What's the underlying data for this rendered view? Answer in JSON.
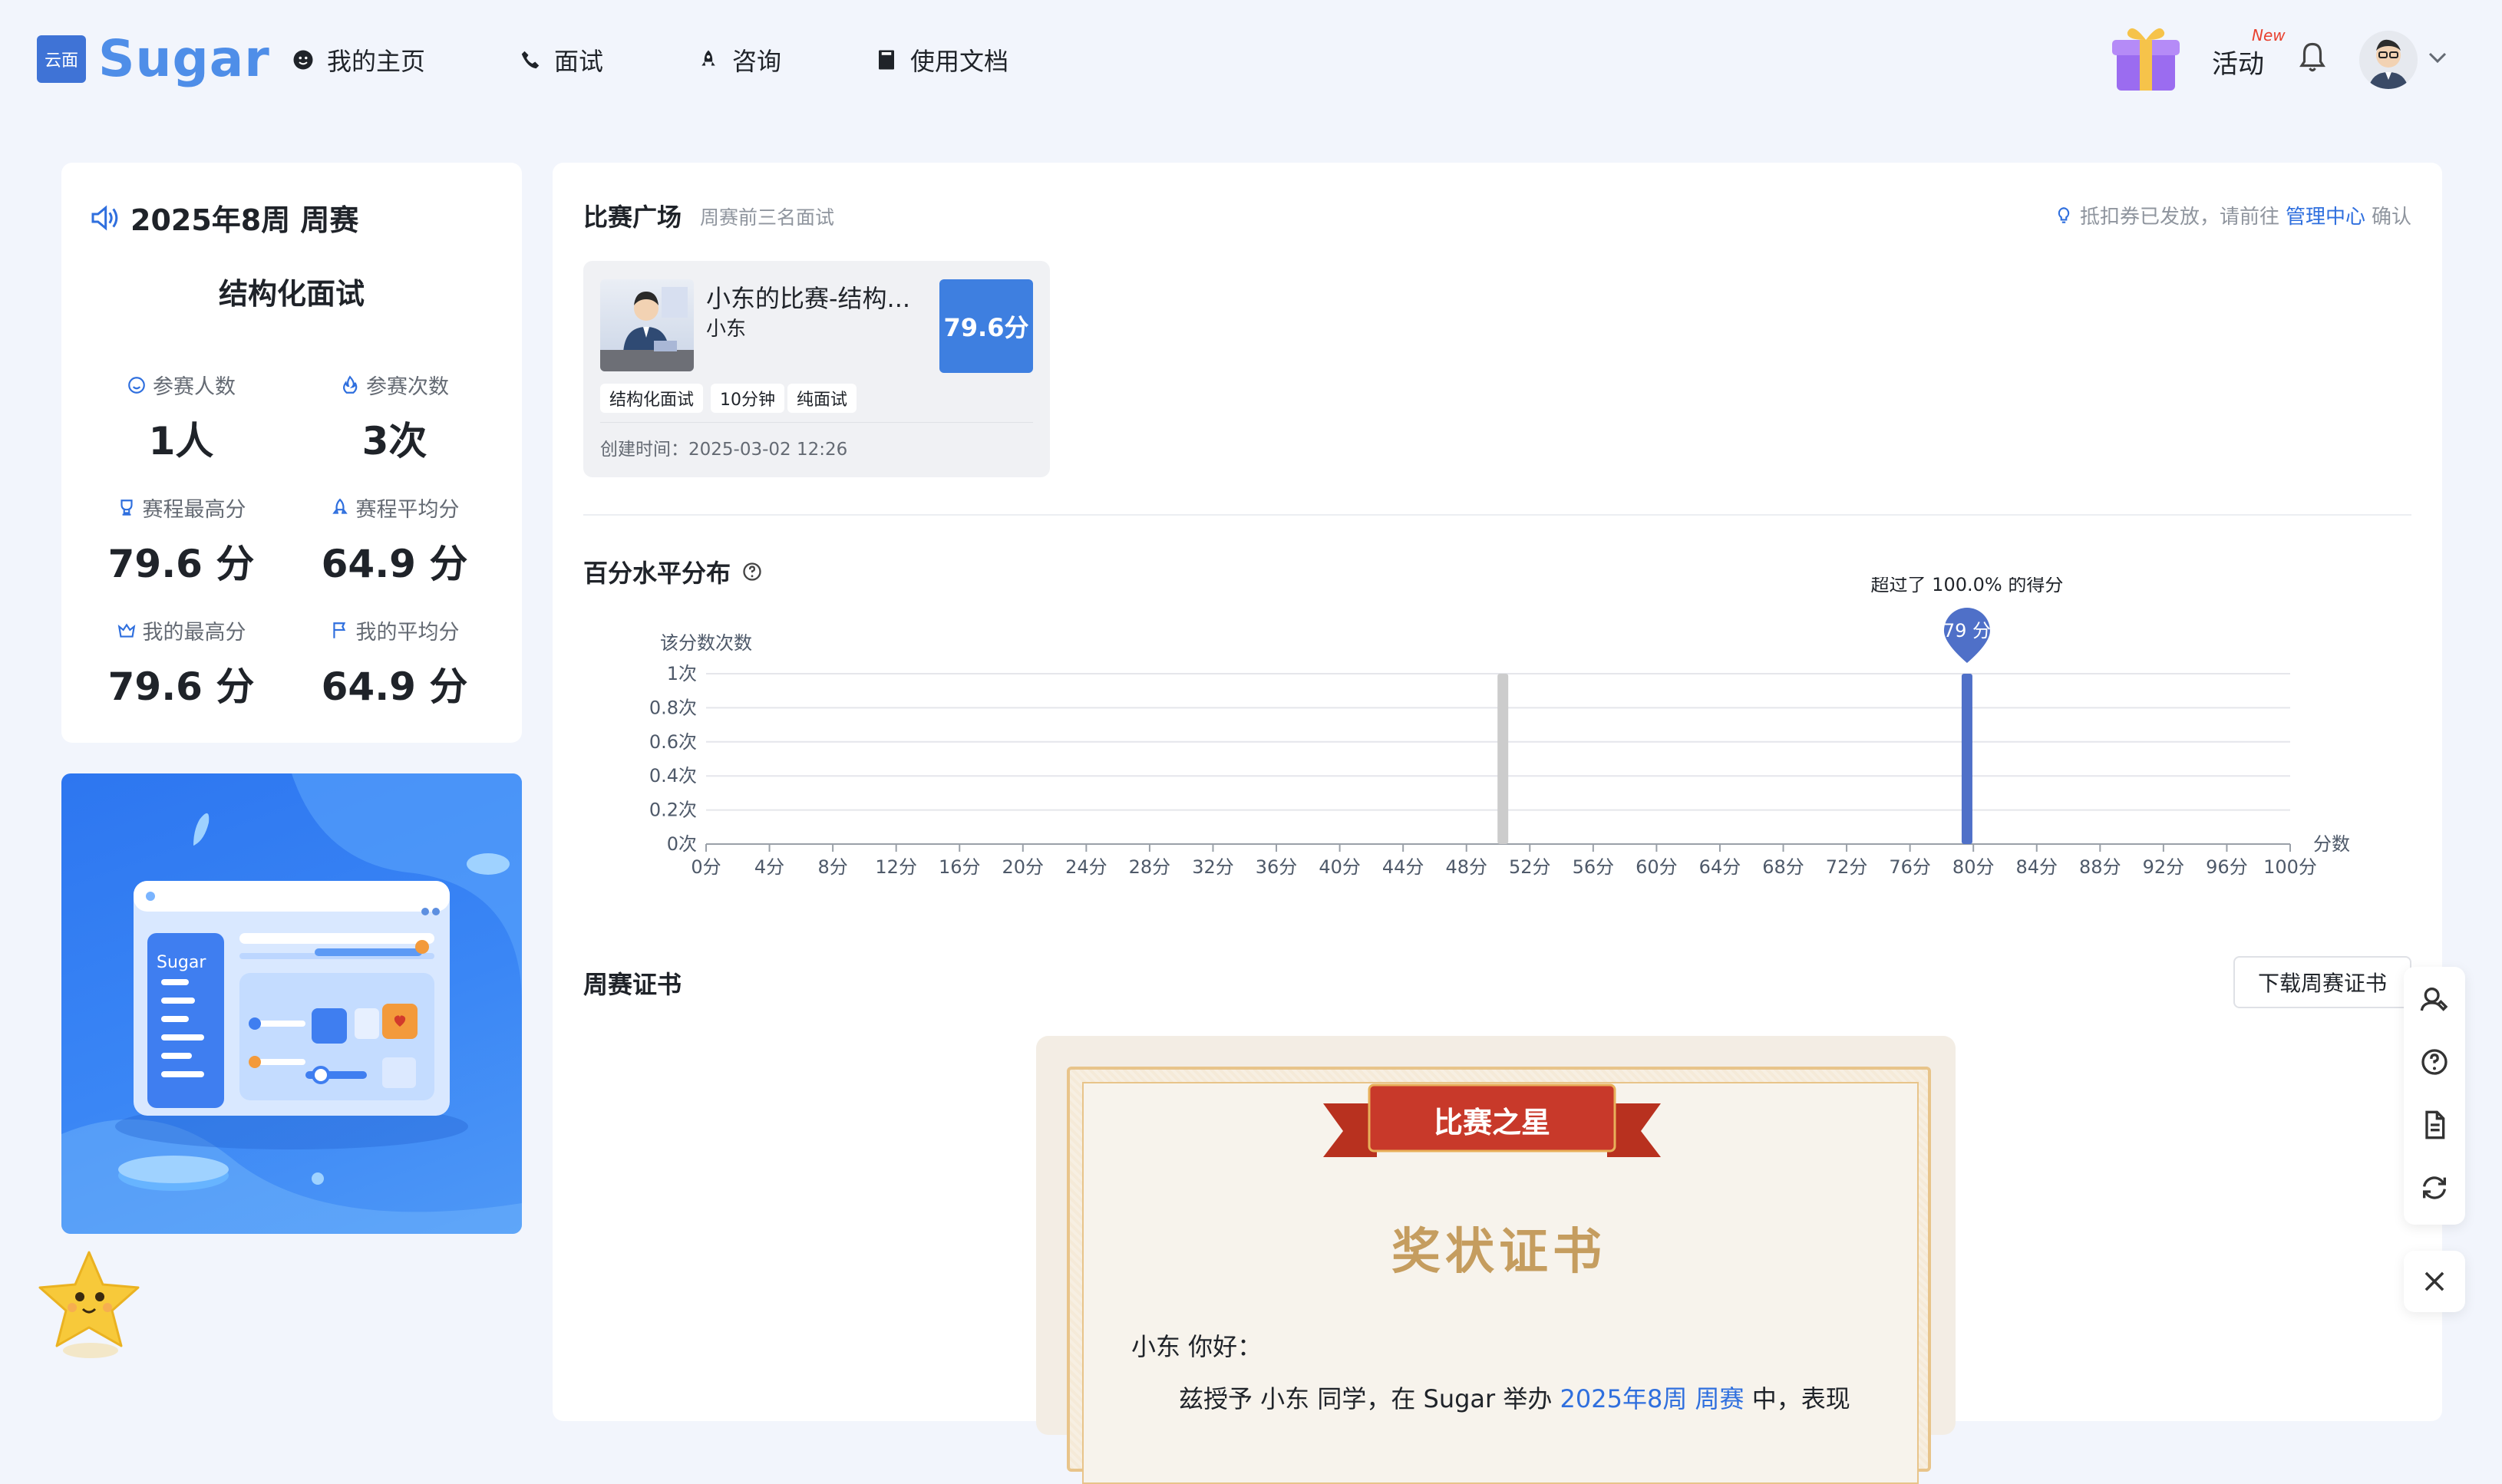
{
  "header": {
    "logo_badge": "云面",
    "logo_text": "Sugar",
    "nav": [
      {
        "label": "我的主页",
        "icon": "face-icon"
      },
      {
        "label": "面试",
        "icon": "phone-icon"
      },
      {
        "label": "咨询",
        "icon": "rocket-icon"
      },
      {
        "label": "使用文档",
        "icon": "book-icon"
      }
    ],
    "activity_label": "活动",
    "new_badge": "New"
  },
  "stats": {
    "title": "2025年8周 周赛",
    "subtitle": "结构化面试",
    "items": [
      {
        "label": "参赛人数",
        "value": "1人",
        "icon": "smile-icon"
      },
      {
        "label": "参赛次数",
        "value": "3次",
        "icon": "flame-icon"
      },
      {
        "label": "赛程最高分",
        "value": "79.6 分",
        "icon": "trophy-icon"
      },
      {
        "label": "赛程平均分",
        "value": "64.9 分",
        "icon": "rocket-icon"
      },
      {
        "label": "我的最高分",
        "value": "79.6 分",
        "icon": "crown-icon"
      },
      {
        "label": "我的平均分",
        "value": "64.9 分",
        "icon": "flag-icon"
      }
    ]
  },
  "promo": {
    "window_label": "Sugar"
  },
  "competition": {
    "title": "比赛广场",
    "subtitle": "周赛前三名面试",
    "notice_pre": "抵扣券已发放，请前往",
    "notice_link": "管理中心",
    "notice_post": "确认",
    "card": {
      "name": "小东的比赛-结构...",
      "owner": "小东",
      "score": "79.6分",
      "tags": [
        "结构化面试",
        "10分钟",
        "纯面试"
      ],
      "created": "创建时间：2025-03-02 12:26"
    }
  },
  "distribution": {
    "title": "百分水平分布",
    "tooltip": "超过了 100.0% 的得分",
    "marker": "79 分"
  },
  "chart_data": {
    "type": "bar",
    "ylabel": "该分数次数",
    "xlabel": "分数",
    "ylim": [
      0,
      1
    ],
    "yticks": [
      "0次",
      "0.2次",
      "0.4次",
      "0.6次",
      "0.8次",
      "1次"
    ],
    "xticks": [
      "0分",
      "4分",
      "8分",
      "12分",
      "16分",
      "20分",
      "24分",
      "28分",
      "32分",
      "36分",
      "40分",
      "44分",
      "48分",
      "52分",
      "56分",
      "60分",
      "64分",
      "68分",
      "72分",
      "76分",
      "80分",
      "84分",
      "88分",
      "92分",
      "96分",
      "100分"
    ],
    "xlim": [
      0,
      100
    ],
    "bars": [
      {
        "x": 50.3,
        "value": 1,
        "color": "#cccccc"
      },
      {
        "x": 79.6,
        "value": 1,
        "color": "#4f70c8"
      }
    ],
    "grid": true
  },
  "certificate": {
    "section_title": "周赛证书",
    "download_label": "下载周赛证书",
    "ribbon": "比赛之星",
    "title": "奖状证书",
    "greeting": "小东 你好：",
    "body_pre": "兹授予 小东 同学，在 Sugar 举办",
    "body_link": "2025年8周 周赛",
    "body_post": "中，表现"
  },
  "colors": {
    "accent": "#3e7fe0",
    "bar_highlight": "#4f70c8",
    "bar_other": "#cccccc",
    "cert_gold": "#c59d5f",
    "ribbon_red": "#c8392a"
  }
}
